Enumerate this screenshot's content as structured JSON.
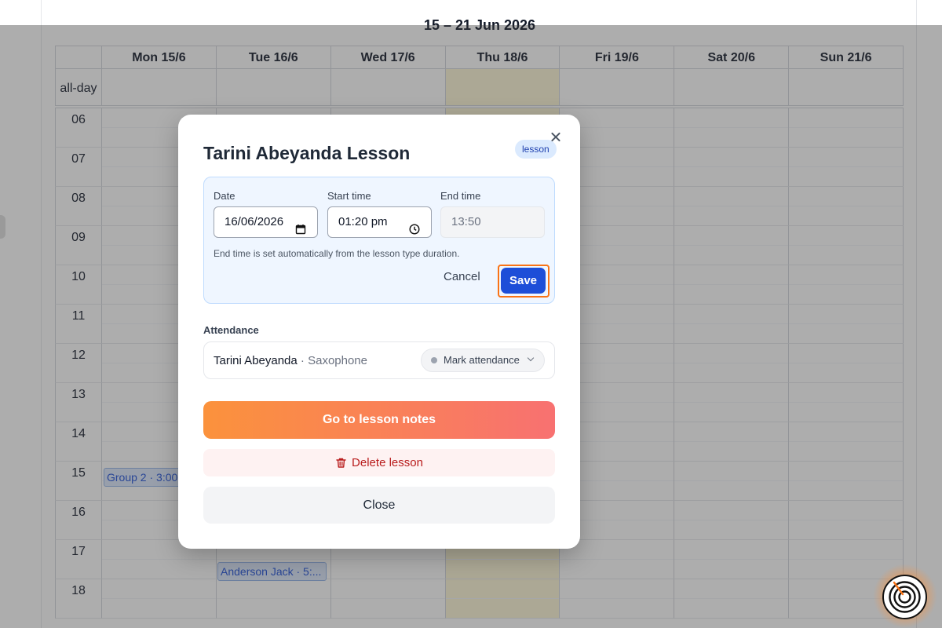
{
  "calendar": {
    "week_title": "15 – 21 Jun 2026",
    "days": [
      "Mon 15/6",
      "Tue 16/6",
      "Wed 17/6",
      "Thu 18/6",
      "Fri 19/6",
      "Sat 20/6",
      "Sun 21/6"
    ],
    "allday_label": "all-day",
    "hours": [
      "06",
      "07",
      "08",
      "09",
      "10",
      "11",
      "12",
      "13",
      "14",
      "15",
      "16",
      "17",
      "18"
    ],
    "events": [
      {
        "label": "Group 2 · 3:00"
      },
      {
        "label": "Anderson Jack · 5:..."
      }
    ]
  },
  "modal": {
    "title": "Tarini Abeyanda Lesson",
    "badge": "lesson",
    "date_label": "Date",
    "date_value": "16/06/2026",
    "start_label": "Start time",
    "start_value": "01:20 pm",
    "end_label": "End time",
    "end_value": "13:50",
    "hint": "End time is set automatically from the lesson type duration.",
    "cancel_label": "Cancel",
    "save_label": "Save",
    "attendance_label": "Attendance",
    "attendee_name": "Tarini Abeyanda",
    "attendee_separator": " · ",
    "attendee_instrument": "Saxophone",
    "attendance_status": "Mark attendance",
    "notes_button": "Go to lesson notes",
    "delete_button": "Delete lesson",
    "close_button": "Close"
  },
  "colors": {
    "accent": "#1d4ed8",
    "highlight": "#f97316",
    "danger": "#b91c1c",
    "today": "#fdf7d6"
  },
  "icons": {
    "date": "calendar-icon",
    "time": "clock-icon",
    "delete": "trash-icon",
    "close": "close-icon",
    "fab": "concentric-circles-icon"
  }
}
